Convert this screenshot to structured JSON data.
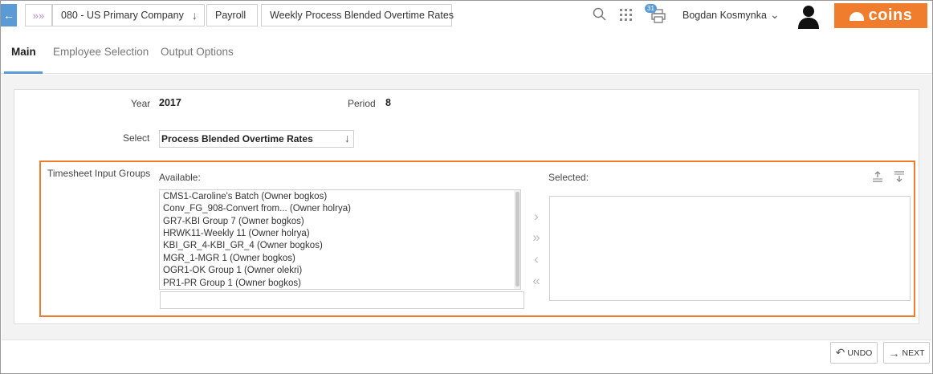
{
  "header": {
    "back_icon": "arrow-left-icon",
    "home_icon": "chevrons-right-icon",
    "breadcrumb": {
      "company": "080 - US Primary Company",
      "module": "Payroll",
      "page": "Weekly Process Blended Overtime Rates"
    },
    "print_badge": "31",
    "user_name": "Bogdan Kosmynka",
    "logo_text": "coins",
    "accent_color": "#f07d2d",
    "brand_blue": "#5b9bd5"
  },
  "tabs": {
    "main": "Main",
    "employee_selection": "Employee Selection",
    "output_options": "Output Options"
  },
  "form": {
    "year_label": "Year",
    "year_value": "2017",
    "period_label": "Period",
    "period_value": "8",
    "select_label": "Select",
    "select_value": "Process Blended Overtime Rates",
    "groups_label": "Timesheet Input Groups",
    "available_label": "Available:",
    "selected_label": "Selected:",
    "available_items": [
      "CMS1-Caroline's Batch (Owner bogkos)",
      "Conv_FG_908-Convert from... (Owner holrya)",
      "GR7-KBI Group 7 (Owner bogkos)",
      "HRWK11-Weekly 11 (Owner holrya)",
      "KBI_GR_4-KBI_GR_4 (Owner bogkos)",
      "MGR_1-MGR 1 (Owner bogkos)",
      "OGR1-OK Group 1 (Owner olekri)",
      "PR1-PR Group 1 (Owner bogkos)"
    ],
    "selected_items": []
  },
  "footer": {
    "undo": "UNDO",
    "next": "NEXT"
  }
}
